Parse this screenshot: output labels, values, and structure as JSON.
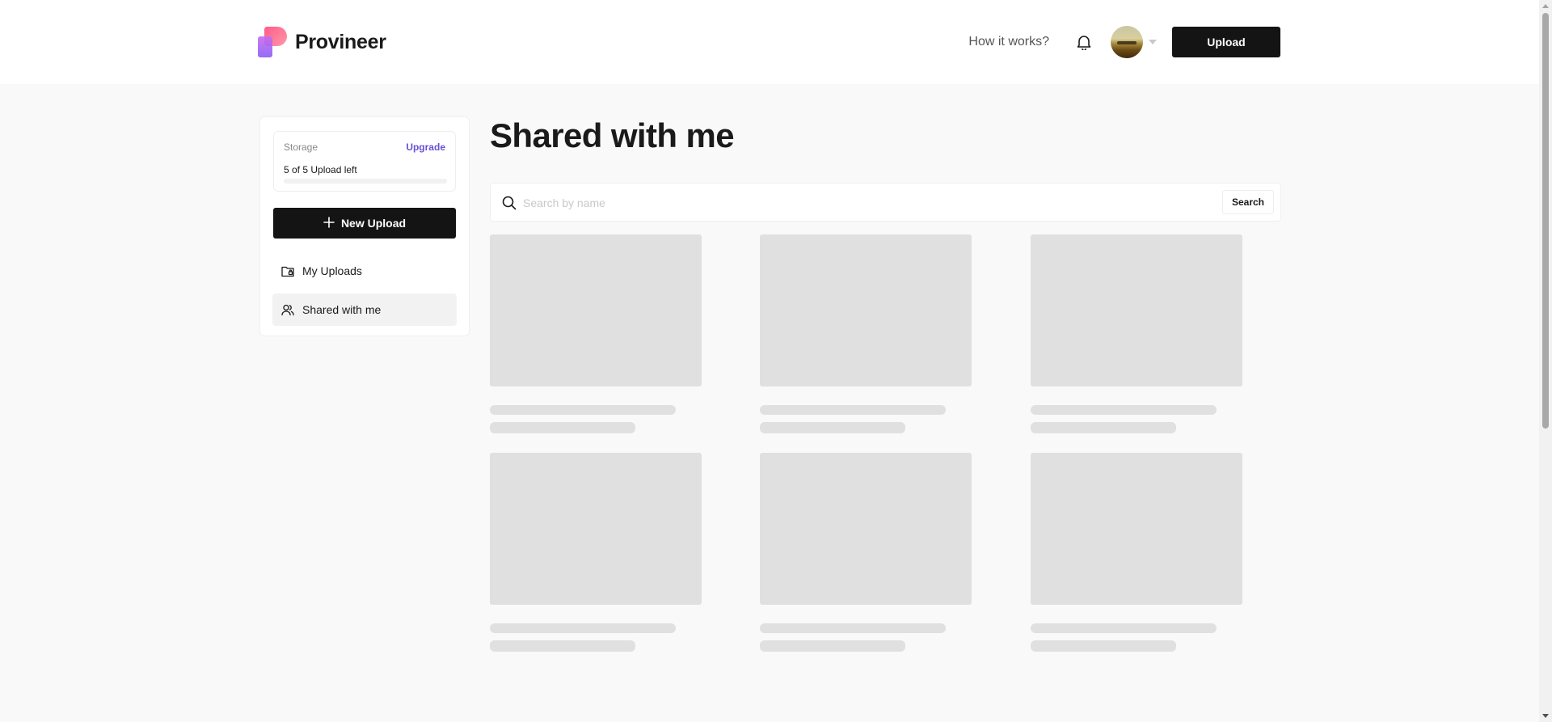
{
  "header": {
    "brand_name": "Provineer",
    "how_it_works": "How it works?",
    "upload_label": "Upload"
  },
  "sidebar": {
    "storage_label": "Storage",
    "upgrade_label": "Upgrade",
    "uploads_left": "5 of 5 Upload left",
    "storage_used_fraction": 0,
    "new_upload_label": "New Upload",
    "nav": [
      {
        "label": "My Uploads",
        "icon": "folder-icon",
        "active": false
      },
      {
        "label": "Shared with me",
        "icon": "users-icon",
        "active": true
      }
    ]
  },
  "main": {
    "title": "Shared with me",
    "search": {
      "placeholder": "Search by name",
      "value": "",
      "button_label": "Search"
    },
    "skeleton_cards": 6
  },
  "colors": {
    "primary": "#141414",
    "accent": "#6a4fd8",
    "skeleton": "#e0e0e0",
    "background": "#f9f9f9"
  }
}
